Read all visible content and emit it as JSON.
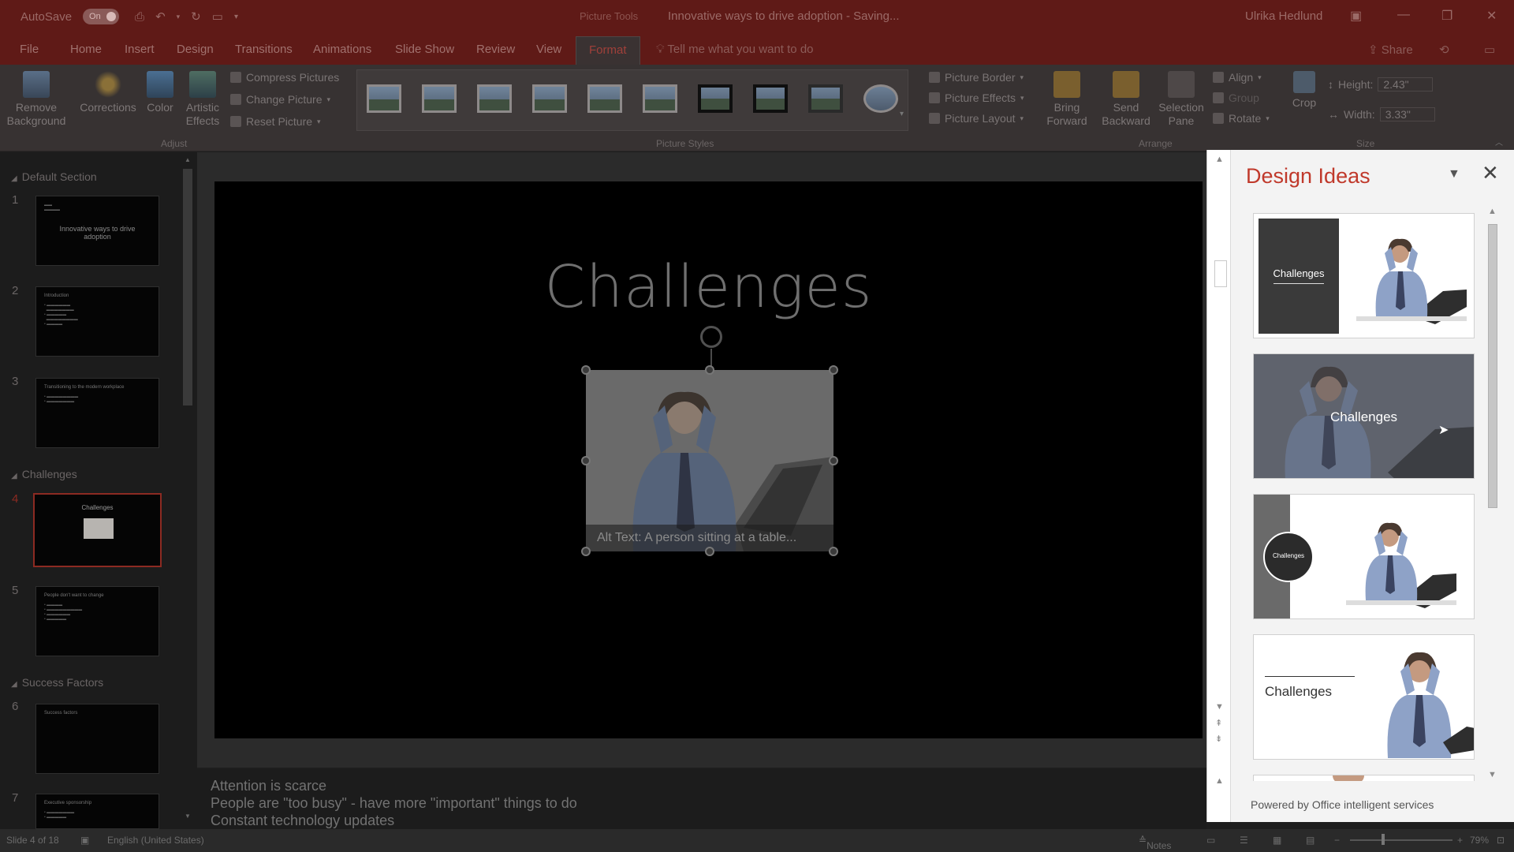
{
  "titlebar": {
    "autosave_label": "AutoSave",
    "autosave_state": "On",
    "context_label": "Picture Tools",
    "doc_title": "Innovative ways to drive adoption  -  Saving...",
    "user": "Ulrika Hedlund"
  },
  "tabs": [
    "File",
    "Home",
    "Insert",
    "Design",
    "Transitions",
    "Animations",
    "Slide Show",
    "Review",
    "View",
    "Format"
  ],
  "active_tab": "Format",
  "tell_me": "Tell me what you want to do",
  "share": "Share",
  "ribbon": {
    "remove_background": "Remove\nBackground",
    "corrections": "Corrections",
    "color": "Color",
    "artistic_effects": "Artistic\nEffects",
    "compress_pictures": "Compress Pictures",
    "change_picture": "Change Picture",
    "reset_picture": "Reset Picture",
    "adjust_label": "Adjust",
    "picture_styles_label": "Picture Styles",
    "picture_border": "Picture Border",
    "picture_effects": "Picture Effects",
    "picture_layout": "Picture Layout",
    "bring_forward": "Bring\nForward",
    "send_backward": "Send\nBackward",
    "selection_pane": "Selection\nPane",
    "align": "Align",
    "group": "Group",
    "rotate": "Rotate",
    "arrange_label": "Arrange",
    "crop": "Crop",
    "height_label": "Height:",
    "height_value": "2.43\"",
    "width_label": "Width:",
    "width_value": "3.33\"",
    "size_label": "Size"
  },
  "thumbnails": {
    "sections": [
      "Default Section",
      "Challenges",
      "Success Factors"
    ],
    "slides": [
      {
        "num": "1",
        "title": "Innovative ways to drive adoption"
      },
      {
        "num": "2",
        "title": "Introduction"
      },
      {
        "num": "3",
        "title": "Transitioning to the modern workplace"
      },
      {
        "num": "4",
        "title": "Challenges"
      },
      {
        "num": "5",
        "title": "People don't want to change"
      },
      {
        "num": "6",
        "title": "Success factors"
      },
      {
        "num": "7",
        "title": "Executive sponsorship"
      }
    ]
  },
  "slide": {
    "title": "Challenges",
    "alt_text": "Alt Text: A person sitting at a table..."
  },
  "notes": [
    "Attention is scarce",
    "People are \"too busy\" - have more \"important\" things to do",
    "Constant technology updates"
  ],
  "status": {
    "slide_of": "Slide 4 of 18",
    "language": "English (United States)",
    "notes": "Notes",
    "zoom": "79%"
  },
  "design_ideas": {
    "title": "Design Ideas",
    "ideas": [
      {
        "label": "Challenges"
      },
      {
        "label": "Challenges"
      },
      {
        "label": "Challenges"
      },
      {
        "label": "Challenges"
      }
    ],
    "footer": "Powered by Office intelligent services"
  },
  "colors": {
    "accent": "#c0392b",
    "titlebar": "#5f1a17",
    "selected_thumb_border": "#8c2a22"
  }
}
